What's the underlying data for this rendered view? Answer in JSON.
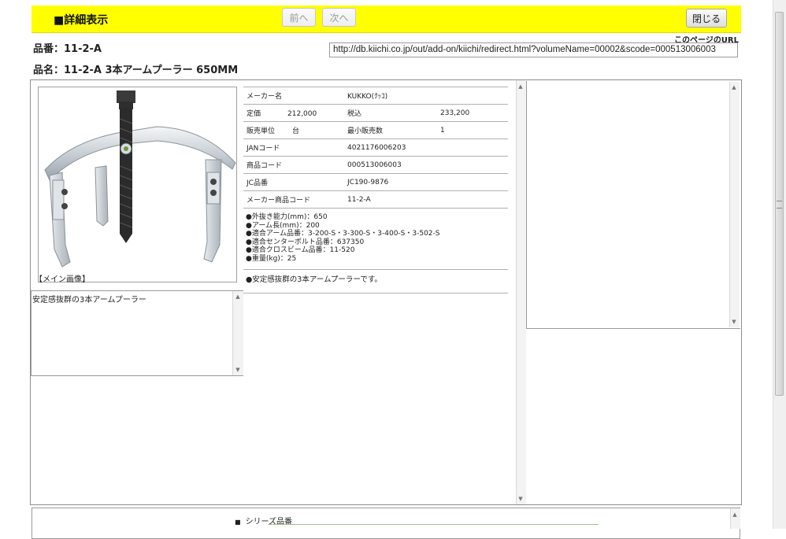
{
  "header": {
    "title": "■詳細表示",
    "prev_label": "前へ",
    "next_label": "次へ",
    "close_label": "閉じる",
    "accent_color": "#ffff00"
  },
  "product": {
    "hinban_line": "品番：11-2-A",
    "hinmei_line": "品名：11-2-A 3本アームプーラー 650MM"
  },
  "url": {
    "label": "このページのURL",
    "value": "http://db.kiichi.co.jp/out/add-on/kiichi/redirect.html?volumeName=00002&scode=000513006003"
  },
  "image": {
    "caption": "【メイン画像】",
    "alt": "3-arm puller product photo"
  },
  "description": {
    "text": "安定感抜群の3本アームプーラー"
  },
  "spec": {
    "maker_label": "メーカー名",
    "maker_value": "KUKKO(ｸｯｺ)",
    "list_price_label": "定価",
    "list_price_value": "212,000",
    "tax_incl_label": "税込",
    "tax_incl_value": "233,200",
    "unit_label": "販売単位",
    "unit_value": "台",
    "min_qty_label": "最小販売数",
    "min_qty_value": "1",
    "jan_label": "JANコード",
    "jan_value": "4021176006203",
    "code_label": "商品コード",
    "code_value": "000513006003",
    "jc_label": "JC品番",
    "jc_value": "JC190-9876",
    "maker_code_label": "メーカー商品コード",
    "maker_code_value": "11-2-A"
  },
  "features": [
    "●外抜き能力(mm)：650",
    "●アーム長(mm)：200",
    "●適合アーム品番：3-200-S・3-300-S・3-400-S・3-502-S",
    "●適合センターボルト品番：637350",
    "●適合クロスビーム品番：11-520",
    "●重量(kg)：25"
  ],
  "comment": "●安定感抜群の3本アームプーラーです。",
  "series": {
    "label": "シリーズ品番"
  }
}
